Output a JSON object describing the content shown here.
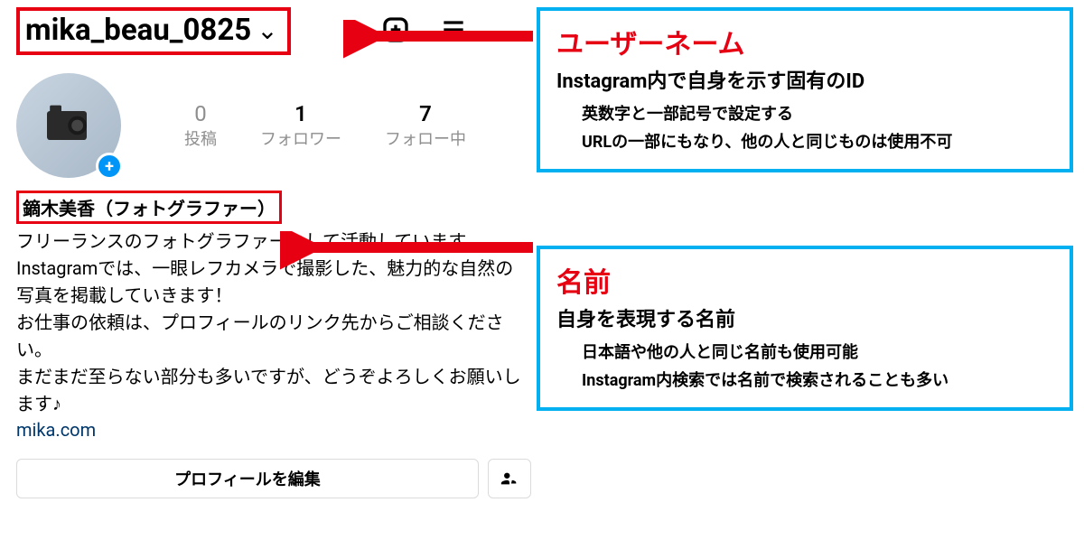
{
  "profile": {
    "username": "mika_beau_0825",
    "stats": {
      "posts": {
        "count": "0",
        "label": "投稿"
      },
      "followers": {
        "count": "1",
        "label": "フォロワー"
      },
      "following": {
        "count": "7",
        "label": "フォロー中"
      }
    },
    "display_name": "鏑木美香（フォトグラファー）",
    "bio_line1": "フリーランスのフォトグラファーとして活動しています。",
    "bio_line2": "Instagramでは、一眼レフカメラで撮影した、魅力的な自然の写真を掲載していきます！",
    "bio_line3": "お仕事の依頼は、プロフィールのリンク先からご相談ください。",
    "bio_line4": "まだまだ至らない部分も多いですが、どうぞよろしくお願いします♪",
    "bio_link": "mika.com",
    "edit_button": "プロフィールを編集"
  },
  "callouts": {
    "username": {
      "title": "ユーザーネーム",
      "subtitle": "Instagram内で自身を示す固有のID",
      "note1": "英数字と一部記号で設定する",
      "note2": "URLの一部にもなり、他の人と同じものは使用不可"
    },
    "name": {
      "title": "名前",
      "subtitle": "自身を表現する名前",
      "note1": "日本語や他の人と同じ名前も使用可能",
      "note2": "Instagram内検索では名前で検索されることも多い"
    }
  }
}
